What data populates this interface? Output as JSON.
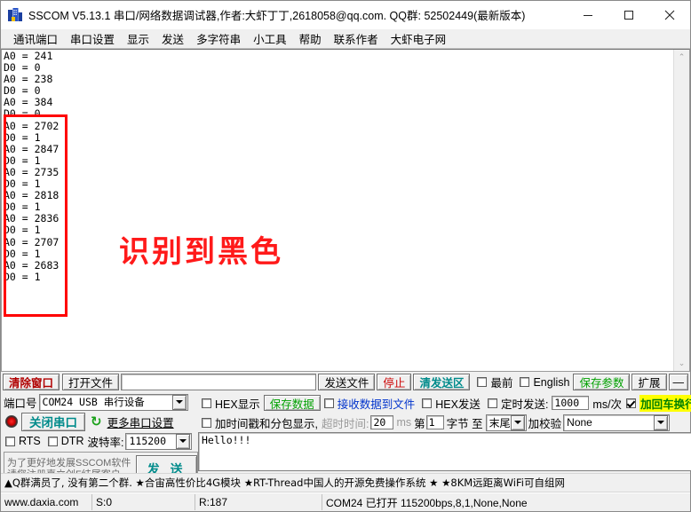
{
  "window": {
    "title": "SSCOM V5.13.1 串口/网络数据调试器,作者:大虾丁丁,2618058@qq.com. QQ群: 52502449(最新版本)",
    "minimize": "–",
    "maximize": "❐",
    "close": "✕"
  },
  "menu": {
    "items": [
      {
        "label": "通讯端口"
      },
      {
        "label": "串口设置"
      },
      {
        "label": "显示"
      },
      {
        "label": "发送"
      },
      {
        "label": "多字符串"
      },
      {
        "label": "小工具"
      },
      {
        "label": "帮助"
      },
      {
        "label": "联系作者"
      },
      {
        "label": "大虾电子网"
      }
    ]
  },
  "receive": {
    "text": "A0 = 241\nD0 = 0\nA0 = 238\nD0 = 0\nA0 = 384\nD0 = 0\nA0 = 2702\nD0 = 1\nA0 = 2847\nD0 = 1\nA0 = 2735\nD0 = 1\nA0 = 2818\nD0 = 1\nA0 = 2836\nD0 = 1\nA0 = 2707\nD0 = 1\nA0 = 2683\nD0 = 1",
    "annotation": "识别到黑色",
    "annotation_color": "#ff1a1a",
    "highlight_box_color": "#ff0000",
    "lines": [
      {
        "key": "A0",
        "value": "241"
      },
      {
        "key": "D0",
        "value": "0"
      },
      {
        "key": "A0",
        "value": "238"
      },
      {
        "key": "D0",
        "value": "0"
      },
      {
        "key": "A0",
        "value": "384"
      },
      {
        "key": "D0",
        "value": "0"
      },
      {
        "key": "A0",
        "value": "2702"
      },
      {
        "key": "D0",
        "value": "1"
      },
      {
        "key": "A0",
        "value": "2847"
      },
      {
        "key": "D0",
        "value": "1"
      },
      {
        "key": "A0",
        "value": "2735"
      },
      {
        "key": "D0",
        "value": "1"
      },
      {
        "key": "A0",
        "value": "2818"
      },
      {
        "key": "D0",
        "value": "1"
      },
      {
        "key": "A0",
        "value": "2836"
      },
      {
        "key": "D0",
        "value": "1"
      },
      {
        "key": "A0",
        "value": "2707"
      },
      {
        "key": "D0",
        "value": "1"
      },
      {
        "key": "A0",
        "value": "2683"
      },
      {
        "key": "D0",
        "value": "1"
      }
    ],
    "scroll_up": "⌃",
    "scroll_down": "⌄"
  },
  "toolbar": {
    "clear_window": "清除窗口",
    "open_file": "打开文件",
    "file_path": "",
    "send_file": "发送文件",
    "stop": "停止",
    "clear_send": "清发送区",
    "topmost_label": "最前",
    "topmost_checked": false,
    "english_label": "English",
    "english_checked": false,
    "save_params": "保存参数",
    "extend": "扩展",
    "minus": "—"
  },
  "settings": {
    "port_label": "端口号",
    "port_value": "COM24 USB 串行设备",
    "close_port_button": "关闭串口",
    "refresh_icon": "↻",
    "more_settings": "更多串口设置",
    "rts_label": "RTS",
    "rts_checked": false,
    "dtr_label": "DTR",
    "dtr_checked": false,
    "baud_label": "波特率:",
    "baud_value": "115200",
    "promo_line1": "为了更好地发展SSCOM软件",
    "promo_line2": "请您注册嘉立创F结尾客户",
    "send_button": "发 送",
    "hex_display_label": "HEX显示",
    "hex_display_checked": false,
    "save_data_button": "保存数据",
    "recv_to_file_label": "接收数据到文件",
    "recv_to_file_checked": false,
    "timestamp_label": "加时间戳和分包显示,",
    "timestamp_checked": false,
    "timeout_label": "超时时间:",
    "timeout_value": "20",
    "timeout_unit": "ms",
    "byte_prefix": "第",
    "byte_index": "1",
    "byte_label": "字节 至",
    "byte_end": "末尾",
    "checksum_label": "加校验",
    "checksum_value": "None",
    "hex_send_label": "HEX发送",
    "hex_send_checked": false,
    "timed_send_label": "定时发送:",
    "timed_send_checked": false,
    "timed_send_value": "1000",
    "timed_send_unit": "ms/次",
    "crlf_label": "加回车换行",
    "crlf_checked": true,
    "help_mark": "?",
    "send_text": "Hello!!!"
  },
  "adbar": {
    "text": "▲Q群满员了, 没有第二个群. ★合宙高性价比4G模块  ★RT-Thread中国人的开源免费操作系统 ★  ★8KM远距离WiFi可自组网"
  },
  "statusbar": {
    "website": "www.daxia.com",
    "sent": "S:0",
    "received": "R:187",
    "connection": "COM24 已打开  115200bps,8,1,None,None"
  },
  "colors": {
    "accent_teal": "#008b8b",
    "accent_green": "#00a000",
    "accent_red": "#cc0000",
    "accent_blue": "#0033cc",
    "highlight_yellow": "#ffff00"
  }
}
